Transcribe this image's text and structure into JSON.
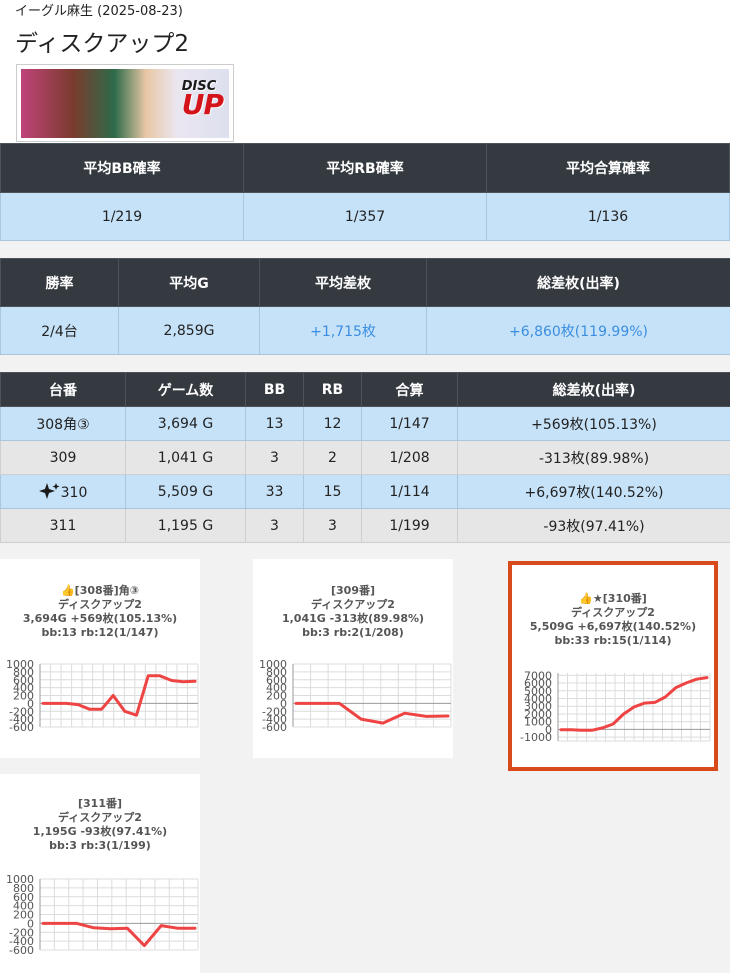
{
  "header": {
    "subtitle": "イーグル麻生 (2025-08-23)",
    "title": "ディスクアップ2",
    "banner_logo_top": "DISC",
    "banner_logo_main": "UP"
  },
  "avg_prob": {
    "headers": [
      "平均BB確率",
      "平均RB確率",
      "平均合算確率"
    ],
    "values": [
      "1/219",
      "1/357",
      "1/136"
    ]
  },
  "summary": {
    "headers": [
      "勝率",
      "平均G",
      "平均差枚",
      "総差枚(出率)"
    ],
    "values": [
      "2/4台",
      "2,859G",
      "+1,715枚",
      "+6,860枚(119.99%)"
    ]
  },
  "machines": {
    "headers": [
      "台番",
      "ゲーム数",
      "BB",
      "RB",
      "合算",
      "総差枚(出率)"
    ],
    "rows": [
      {
        "no": "308角③",
        "games": "3,694 G",
        "bb": "13",
        "rb": "12",
        "total": "1/147",
        "diff": "+569枚(105.13%)",
        "icon": ""
      },
      {
        "no": "309",
        "games": "1,041 G",
        "bb": "3",
        "rb": "2",
        "total": "1/208",
        "diff": "-313枚(89.98%)",
        "icon": ""
      },
      {
        "no": "310",
        "games": "5,509 G",
        "bb": "33",
        "rb": "15",
        "total": "1/114",
        "diff": "+6,697枚(140.52%)",
        "icon": "sparkle-icon"
      },
      {
        "no": "311",
        "games": "1,195 G",
        "bb": "3",
        "rb": "3",
        "total": "1/199",
        "diff": "-93枚(97.41%)",
        "icon": ""
      }
    ]
  },
  "cards": [
    {
      "line1": "👍[308番]角③",
      "line2": "ディスクアップ2",
      "line3": "3,694G +569枚(105.13%)",
      "line4": "bb:13 rb:12(1/147)"
    },
    {
      "line1": "[309番]",
      "line2": "ディスクアップ2",
      "line3": "1,041G -313枚(89.98%)",
      "line4": "bb:3 rb:2(1/208)"
    },
    {
      "line1": "👍★[310番]",
      "line2": "ディスクアップ2",
      "line3": "5,509G +6,697枚(140.52%)",
      "line4": "bb:33 rb:15(1/114)"
    },
    {
      "line1": "[311番]",
      "line2": "ディスクアップ2",
      "line3": "1,195G -93枚(97.41%)",
      "line4": "bb:3 rb:3(1/199)"
    }
  ],
  "chart_data": [
    {
      "type": "line",
      "ylim": [
        -600,
        1000
      ],
      "yticks": [
        1000,
        800,
        600,
        400,
        200,
        0,
        -200,
        -400,
        -600
      ],
      "ytick_labels": [
        "1000",
        "800",
        "600",
        "400",
        "200",
        "0",
        "-200",
        "-400",
        "-600"
      ],
      "x": [
        0,
        1,
        2,
        3,
        4,
        5,
        6,
        7,
        8,
        9,
        10,
        11,
        12,
        13
      ],
      "values": [
        0,
        0,
        0,
        -30,
        -150,
        -150,
        200,
        -200,
        -300,
        700,
        700,
        580,
        550,
        560
      ],
      "color": "#ee4444"
    },
    {
      "type": "line",
      "ylim": [
        -600,
        1000
      ],
      "yticks": [
        1000,
        800,
        600,
        400,
        200,
        0,
        -200,
        -400,
        -600
      ],
      "ytick_labels": [
        "1000",
        "800",
        "600",
        "400",
        "200",
        "0",
        "-200",
        "-400",
        "-600"
      ],
      "x": [
        0,
        1,
        2,
        3,
        4,
        5,
        6,
        7
      ],
      "values": [
        0,
        0,
        0,
        -400,
        -500,
        -250,
        -330,
        -320
      ],
      "color": "#ee4444"
    },
    {
      "type": "line",
      "ylim": [
        -1500,
        7300
      ],
      "yticks": [
        7000,
        6000,
        5000,
        4000,
        3000,
        2000,
        1000,
        0,
        -1000
      ],
      "ytick_labels": [
        "7000",
        "6000",
        "5000",
        "4000",
        "3000",
        "2000",
        "1000",
        "0",
        "-1000"
      ],
      "x": [
        0,
        1,
        2,
        3,
        4,
        5,
        6,
        7,
        8,
        9,
        10,
        11,
        12,
        13,
        14
      ],
      "values": [
        -50,
        -50,
        -100,
        -100,
        200,
        700,
        2000,
        2900,
        3400,
        3500,
        4200,
        5400,
        6000,
        6500,
        6700
      ],
      "color": "#ee4444"
    },
    {
      "type": "line",
      "ylim": [
        -600,
        1000
      ],
      "yticks": [
        1000,
        800,
        600,
        400,
        200,
        0,
        -200,
        -400,
        -600
      ],
      "ytick_labels": [
        "1000",
        "800",
        "600",
        "400",
        "200",
        "0",
        "-200",
        "-400",
        "-600"
      ],
      "x": [
        0,
        1,
        2,
        3,
        4,
        5,
        6,
        7,
        8,
        9
      ],
      "values": [
        0,
        0,
        0,
        -100,
        -120,
        -110,
        -500,
        -50,
        -110,
        -110
      ],
      "color": "#ee4444"
    }
  ]
}
